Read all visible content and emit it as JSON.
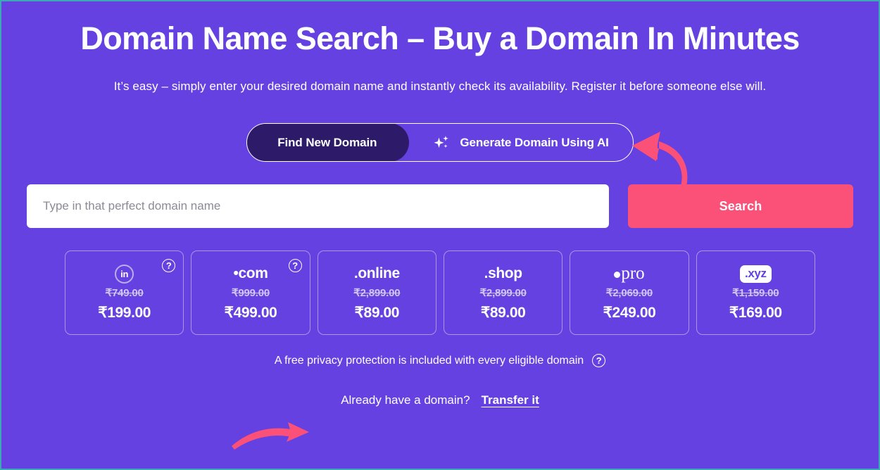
{
  "theme": {
    "background": "#6441e0",
    "border": "#3aa9b5",
    "accent_pink": "#fb5179",
    "active_tab_bg": "#2d1b69",
    "muted_price": "#cfc6f4"
  },
  "hero": {
    "title": "Domain Name Search – Buy a Domain In Minutes",
    "subtitle": "It’s easy – simply enter your desired domain name and instantly check its availability. Register it before someone else will."
  },
  "toggle": {
    "options": [
      {
        "label": "Find New Domain",
        "active": true,
        "icon": ""
      },
      {
        "label": "Generate Domain Using AI",
        "active": false,
        "icon": "sparkle-icon"
      }
    ]
  },
  "search": {
    "placeholder": "Type in that perfect domain name",
    "value": "",
    "button_label": "Search"
  },
  "tlds": [
    {
      "name": ".in",
      "logo_type": "circle-in",
      "logo_text": "in",
      "old_price": "₹749.00",
      "new_price": "₹199.00",
      "help": "?"
    },
    {
      "name": ".com",
      "logo_type": "text",
      "logo_text": "•com",
      "old_price": "₹999.00",
      "new_price": "₹499.00",
      "help": "?"
    },
    {
      "name": ".online",
      "logo_type": "text",
      "logo_text": ".online",
      "old_price": "₹2,899.00",
      "new_price": "₹89.00",
      "help": ""
    },
    {
      "name": ".shop",
      "logo_type": "text",
      "logo_text": ".shop",
      "old_price": "₹2,899.00",
      "new_price": "₹89.00",
      "help": ""
    },
    {
      "name": ".pro",
      "logo_type": "serif-pro",
      "logo_text": "pro",
      "old_price": "₹2,069.00",
      "new_price": "₹249.00",
      "help": ""
    },
    {
      "name": ".xyz",
      "logo_type": "badge-xyz",
      "logo_text": ".xyz",
      "old_price": "₹1,159.00",
      "new_price": "₹169.00",
      "help": ""
    }
  ],
  "privacy": {
    "text": "A free privacy protection is included with every eligible domain",
    "help": "?"
  },
  "transfer": {
    "prompt": "Already have a domain?",
    "link_label": "Transfer it"
  }
}
